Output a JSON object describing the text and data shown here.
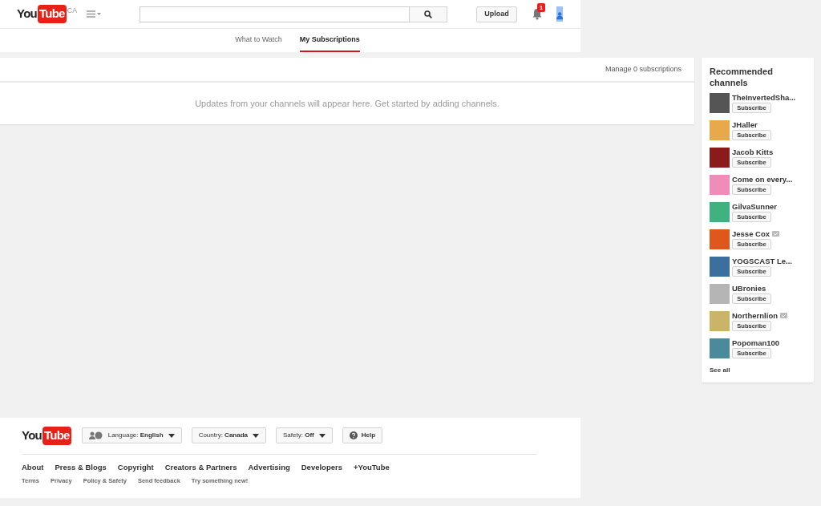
{
  "header": {
    "logo": {
      "part_1": "You",
      "part_2": "Tube"
    },
    "region": "CA",
    "upload": "Upload",
    "notifications": "1"
  },
  "tabs": [
    {
      "label": "What to Watch",
      "selected": false
    },
    {
      "label": "My Subscriptions",
      "selected": true
    }
  ],
  "feed": {
    "manage": "Manage 0 subscriptions",
    "message": "Updates from your channels will appear here. Get started by adding channels."
  },
  "recommended": {
    "title": "Recommended channels",
    "channels": [
      {
        "name": "TheInvertedSha...",
        "verified": false,
        "color": "#555555",
        "button": "Subscribe"
      },
      {
        "name": "JHaller",
        "verified": false,
        "color": "#e8a94a",
        "button": "Subscribe"
      },
      {
        "name": "Jacob Kitts",
        "verified": false,
        "color": "#8b1a1a",
        "button": "Subscribe"
      },
      {
        "name": "Come on every...",
        "verified": false,
        "color": "#f08cb8",
        "button": "Subscribe"
      },
      {
        "name": "GilvaSunner",
        "verified": false,
        "color": "#3fb27f",
        "button": "Subscribe"
      },
      {
        "name": "Jesse Cox",
        "verified": true,
        "color": "#e0571c",
        "button": "Subscribe"
      },
      {
        "name": "YOGSCAST Le...",
        "verified": false,
        "color": "#3a6f9e",
        "button": "Subscribe"
      },
      {
        "name": "UBronies",
        "verified": false,
        "color": "#b5b5b5",
        "button": "Subscribe"
      },
      {
        "name": "Northernlion",
        "verified": true,
        "color": "#c9b46a",
        "button": "Subscribe"
      },
      {
        "name": "Popoman100",
        "verified": false,
        "color": "#4a8a9a",
        "button": "Subscribe"
      }
    ],
    "see_all": "See all"
  },
  "footer": {
    "logo": {
      "part_1": "You",
      "part_2": "Tube"
    },
    "selectors": [
      {
        "kind": "language",
        "label": "Language:",
        "value": "English"
      },
      {
        "kind": "country",
        "label": "Country:",
        "value": "Canada"
      },
      {
        "kind": "safety",
        "label": "Safety:",
        "value": "Off"
      }
    ],
    "help": "Help",
    "primary_links": [
      "About",
      "Press & Blogs",
      "Copyright",
      "Creators & Partners",
      "Advertising",
      "Developers",
      "+YouTube"
    ],
    "secondary_links": [
      "Terms",
      "Privacy",
      "Policy & Safety",
      "Send feedback",
      "Try something new!"
    ]
  }
}
